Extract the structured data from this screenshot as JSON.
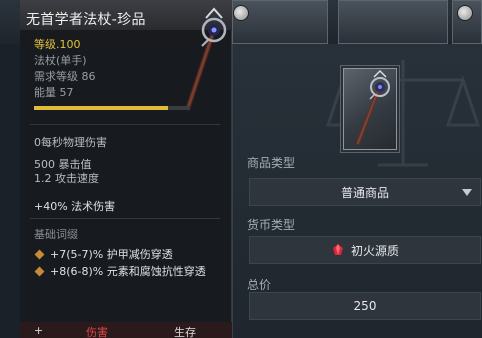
{
  "tooltip": {
    "title": "无首学者法杖-珍品",
    "level_label": "等级.",
    "level_value": "100",
    "weapon_type": "法杖(单手)",
    "required_level": "需求等级 86",
    "energy": "能量 57",
    "energy_fraction": 0.86,
    "damage": "0每秒物理伤害",
    "crit": "500 暴击值",
    "attack_speed": "1.2 攻击速度",
    "spell_damage": "+40% 法术伤害",
    "affix_header": "基础词缀",
    "affixes": [
      "+7(5-7)% 护甲减伤穿透",
      "+8(6-8)% 元素和腐蚀抗性穿透"
    ],
    "tabs": {
      "plus": "+",
      "damage": "伤害",
      "survival": "生存"
    }
  },
  "market": {
    "item_type_label": "商品类型",
    "item_type_value": "普通商品",
    "currency_label": "货币类型",
    "currency_value": "初火源质",
    "total_label": "总价",
    "total_value": "250"
  },
  "colors": {
    "level_gold": "#e2c23a",
    "affix_orange": "#c78a36",
    "active_tab_red": "#e24646",
    "gem_red": "#d8283a"
  },
  "icons": [
    "staff-icon",
    "dropdown-arrow-icon",
    "ember-gem-icon",
    "diamond-bullet-icon",
    "scale-watermark-icon"
  ]
}
